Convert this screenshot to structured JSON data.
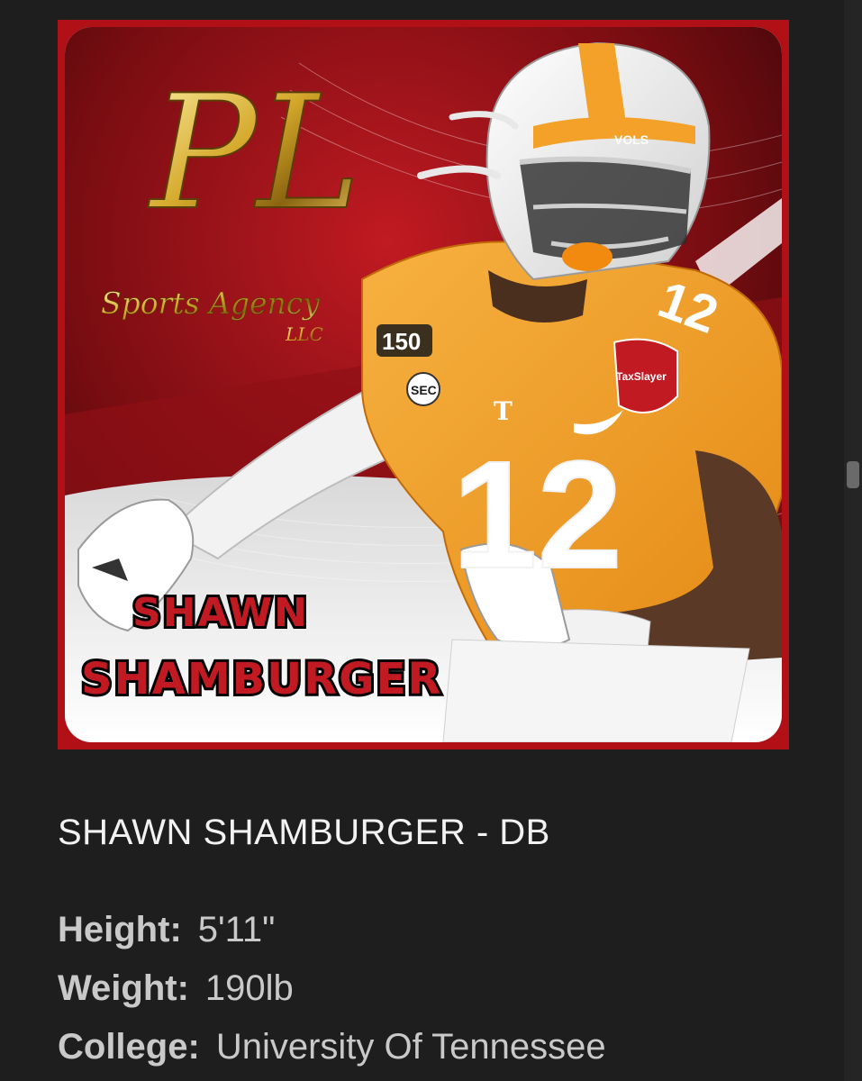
{
  "player": {
    "headline": "SHAWN SHAMBURGER - DB",
    "first_name_art": "SHAWN",
    "last_name_art": "SHAMBURGER",
    "jersey_number": "12"
  },
  "logo": {
    "letters": "PL",
    "line1": "Sports Agency",
    "line2": "LLC"
  },
  "jersey_patches": {
    "anniversary": "150",
    "conference": "SEC",
    "bowl": "TaxSlayer",
    "helmet_text": "VOLS",
    "team_letter": "T"
  },
  "stats": [
    {
      "label": "Height",
      "value": "5'11\""
    },
    {
      "label": "Weight",
      "value": "190lb"
    },
    {
      "label": "College",
      "value": "University Of Tennessee"
    }
  ],
  "colors": {
    "background": "#1e1e1e",
    "card_border": "#b01016",
    "tennessee_orange": "#f4a12a",
    "gold": "#d4a82a"
  }
}
